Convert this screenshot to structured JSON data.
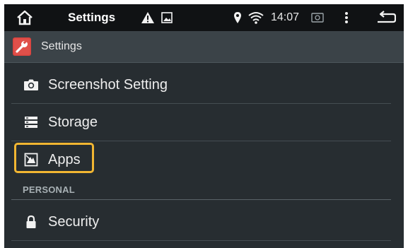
{
  "status_bar": {
    "title": "Settings",
    "time": "14:07",
    "icons": [
      "home-icon",
      "warning-icon",
      "image-icon",
      "location-icon",
      "wifi-icon",
      "screenshot-icon",
      "overflow-menu-icon",
      "back-icon"
    ]
  },
  "header": {
    "title": "Settings",
    "icon": "settings-wrench-icon",
    "icon_color": "#d9443f"
  },
  "list": {
    "items": [
      {
        "label": "Screenshot Setting",
        "icon": "camera-icon"
      },
      {
        "label": "Storage",
        "icon": "storage-icon"
      },
      {
        "label": "Apps",
        "icon": "apps-icon"
      }
    ],
    "section_header": "PERSONAL",
    "personal_items": [
      {
        "label": "Security",
        "icon": "lock-icon"
      }
    ]
  },
  "highlight": {
    "target": "Apps",
    "color": "#f2b632"
  },
  "colors": {
    "background": "#272d31",
    "status_bar": "#101214",
    "header": "#3b4348",
    "text": "#eeeeee",
    "section_header": "#a7b0b4"
  }
}
